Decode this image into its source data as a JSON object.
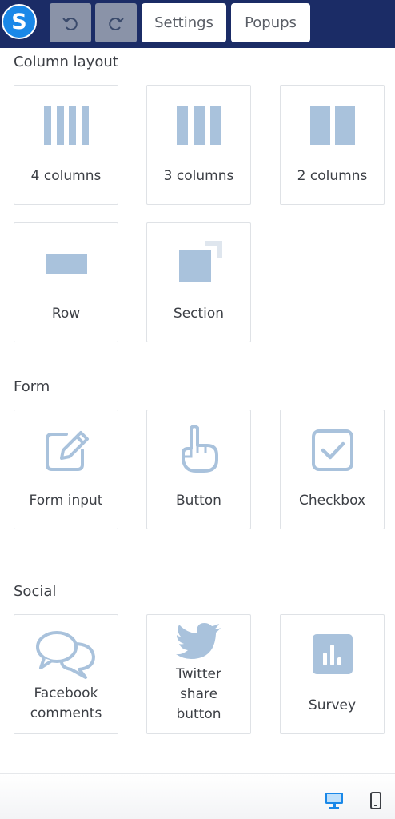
{
  "header": {
    "logo_letter": "S",
    "settings_label": "Settings",
    "popups_label": "Popups"
  },
  "sections": {
    "column_layout": {
      "title": "Column layout",
      "items": [
        {
          "label": "4 columns",
          "icon": "four-columns-icon"
        },
        {
          "label": "3 columns",
          "icon": "three-columns-icon"
        },
        {
          "label": "2 columns",
          "icon": "two-columns-icon"
        },
        {
          "label": "Row",
          "icon": "row-icon"
        },
        {
          "label": "Section",
          "icon": "section-icon"
        }
      ]
    },
    "form": {
      "title": "Form",
      "items": [
        {
          "label": "Form input",
          "icon": "pencil-edit-icon"
        },
        {
          "label": "Button",
          "icon": "pointing-hand-icon"
        },
        {
          "label": "Checkbox",
          "icon": "checkbox-icon"
        }
      ]
    },
    "social": {
      "title": "Social",
      "items": [
        {
          "label": "Facebook\ncomments",
          "icon": "chat-bubbles-icon"
        },
        {
          "label": "Twitter\nshare\nbutton",
          "icon": "twitter-bird-icon"
        },
        {
          "label": "Survey",
          "icon": "bar-chart-icon"
        }
      ]
    }
  },
  "footer": {
    "desktop_icon": "desktop-icon",
    "mobile_icon": "mobile-icon"
  },
  "colors": {
    "header_bg": "#1b2c66",
    "logo_bg": "#1a88e8",
    "icon_fill": "#a9c2dc",
    "active_device": "#1a88e8"
  }
}
